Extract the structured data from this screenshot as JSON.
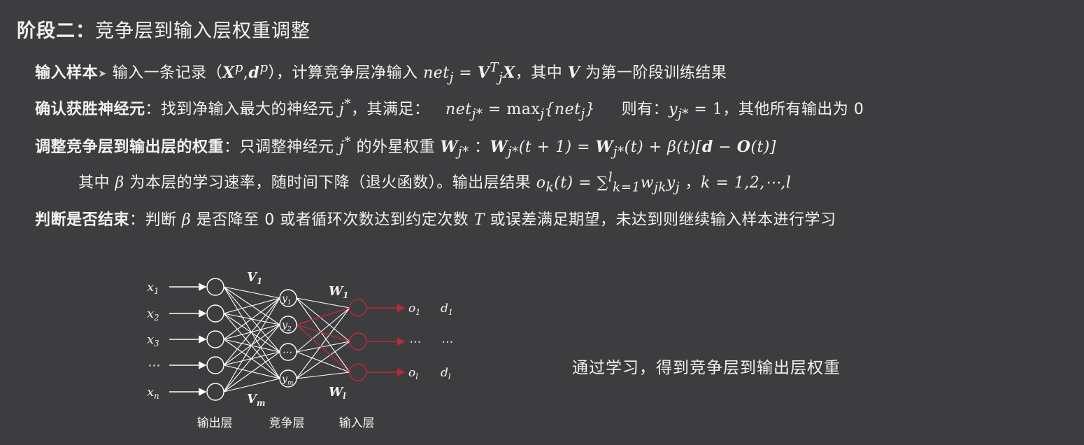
{
  "title": {
    "prefix": "阶段二：",
    "text": "竞争层到输入层权重调整"
  },
  "lines": {
    "input_sample": {
      "term": "输入样本",
      "t1": "输入一条记录（",
      "m_record": "X",
      "sup_p1": "p",
      "m_comma": ",",
      "m_d": "d",
      "sup_p2": "p",
      "t2": "），计算竞争层净输入",
      "m_net": "net",
      "sub_j": "j",
      "m_eq": " = ",
      "m_V": "V",
      "sup_T": "T",
      "sub_j2": "j",
      "m_X": "X",
      "t3": "，其中",
      "m_V2": "V",
      "t4": "为第一阶段训练结果"
    },
    "winner": {
      "term": "确认获胜神经元",
      "t1": "：找到净输入最大的神经元",
      "m_j": "j",
      "sup_star": "*",
      "t2": "，其满足：",
      "m_net": "net",
      "sub_jstar": "j*",
      "m_eq": " = ",
      "m_max": "max",
      "sub_max_j": "j",
      "m_set": "{net",
      "sub_set_j": "j",
      "m_set_end": "}",
      "t3": "则有：",
      "m_y": "y",
      "sub_y": "j*",
      "m_y_eq": " = 1",
      "t4": "，其他所有输出为 0"
    },
    "adjust": {
      "term": "调整竞争层到输出层的权重",
      "t1": "：只调整神经元",
      "m_j": "j",
      "sup_star": "*",
      "t2": "的外星权重",
      "m_W": "W",
      "sub_W": "j*",
      "t3": "：",
      "m_W2": "W",
      "sub_W2": "j*",
      "m_p1": "(t + 1) = ",
      "m_W3": "W",
      "sub_W3": "j*",
      "m_p2": "(t) + β(t)[",
      "m_d": "d",
      "m_minus": " − ",
      "m_O": "O",
      "m_p3": "(t)]"
    },
    "note": {
      "t1": "其中",
      "m_beta": "β",
      "t2": "为本层的学习速率，随时间下降（退火函数）。输出层结果",
      "m_o": "o",
      "sub_k": "k",
      "m_ot": "(t) = ∑",
      "sup_l": "l",
      "sub_k1": "k=1",
      "m_w": "w",
      "sub_jk": "jk",
      "m_y": "y",
      "sub_j": "j",
      "t3": "，",
      "m_k": "k = 1,2,⋯,l"
    },
    "stop": {
      "term": "判断是否结束",
      "t1": "：判断",
      "m_beta": "β",
      "t2": "是否降至 0 或者循环次数达到约定次数",
      "m_T": "T",
      "t3": "或误差满足期望，未达到则继续输入样本进行学习"
    }
  },
  "diagram": {
    "inputs": [
      "x",
      "x",
      "x",
      "⋯",
      "x"
    ],
    "input_subs": [
      "1",
      "2",
      "3",
      "",
      "n"
    ],
    "hidden": [
      "y",
      "y",
      "⋯",
      "y"
    ],
    "hidden_subs": [
      "1",
      "2",
      "",
      "m"
    ],
    "outputs": [
      "o",
      "⋯",
      "o"
    ],
    "output_subs": [
      "1",
      "",
      "l"
    ],
    "targets": [
      "d",
      "⋯",
      "d"
    ],
    "target_subs": [
      "1",
      "",
      "l"
    ],
    "v_top": "V",
    "v_top_sub": "1",
    "v_bot": "V",
    "v_bot_sub": "m",
    "w_top": "W",
    "w_top_sub": "1",
    "w_bot": "W",
    "w_bot_sub": "l",
    "layer_labels": [
      "输出层",
      "竞争层",
      "输入层"
    ],
    "highlight_color": "#c0283a",
    "line_color": "#ffffff"
  },
  "caption": "通过学习，得到竞争层到输出层权重"
}
